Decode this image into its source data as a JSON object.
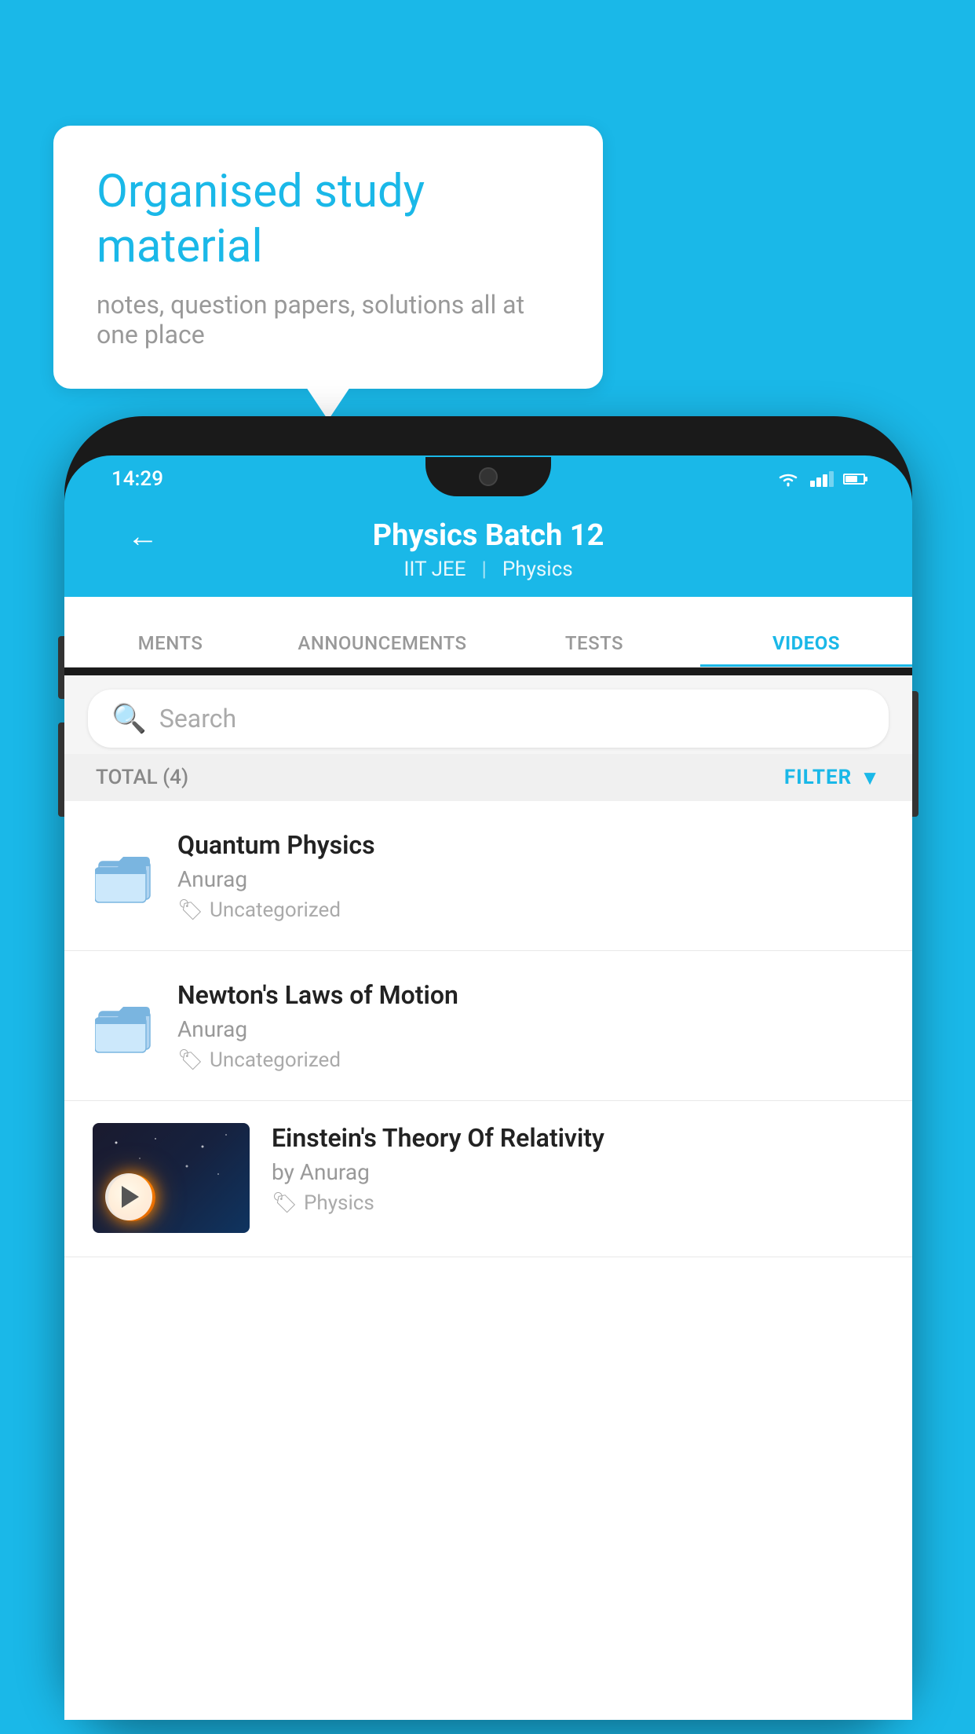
{
  "background": {
    "color": "#1ab8e8"
  },
  "speech_bubble": {
    "title": "Organised study material",
    "subtitle": "notes, question papers, solutions all at one place"
  },
  "phone": {
    "status_bar": {
      "time": "14:29"
    },
    "header": {
      "back_label": "←",
      "title": "Physics Batch 12",
      "subtitle1": "IIT JEE",
      "subtitle2": "Physics"
    },
    "tabs": [
      {
        "label": "MENTS",
        "active": false
      },
      {
        "label": "ANNOUNCEMENTS",
        "active": false
      },
      {
        "label": "TESTS",
        "active": false
      },
      {
        "label": "VIDEOS",
        "active": true
      }
    ],
    "search": {
      "placeholder": "Search"
    },
    "filter": {
      "total_label": "TOTAL (4)",
      "filter_label": "FILTER"
    },
    "videos": [
      {
        "id": 1,
        "title": "Quantum Physics",
        "author": "Anurag",
        "tag": "Uncategorized",
        "has_thumb": false
      },
      {
        "id": 2,
        "title": "Newton's Laws of Motion",
        "author": "Anurag",
        "tag": "Uncategorized",
        "has_thumb": false
      },
      {
        "id": 3,
        "title": "Einstein's Theory Of Relativity",
        "author": "by Anurag",
        "tag": "Physics",
        "has_thumb": true
      }
    ]
  }
}
